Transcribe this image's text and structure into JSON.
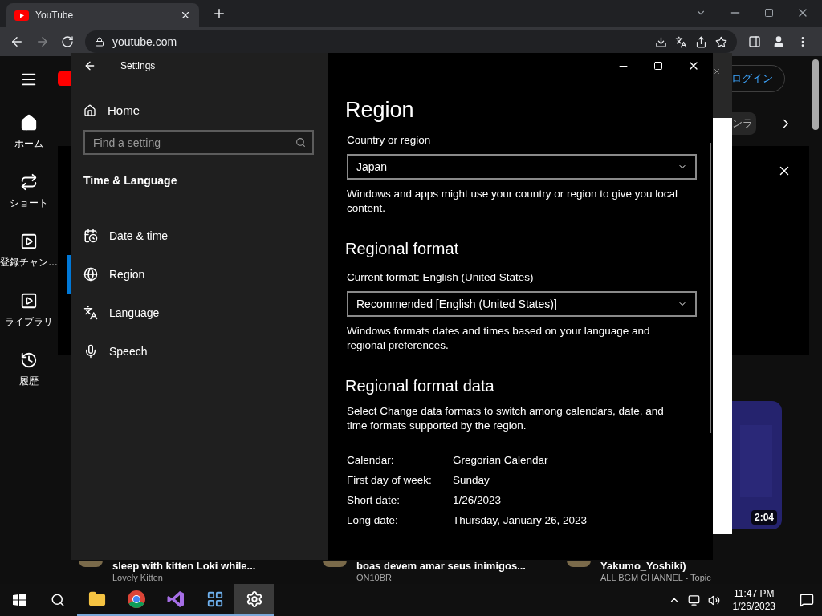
{
  "browser": {
    "tab_title": "YouTube",
    "address": "youtube.com"
  },
  "youtube": {
    "sidebar": [
      {
        "label": "ホーム"
      },
      {
        "label": "ショート"
      },
      {
        "label": "登録チャン…"
      },
      {
        "label": "ライブラリ"
      },
      {
        "label": "履歴"
      }
    ],
    "login": "ログイン",
    "chip": "ンラ",
    "duration": "2:04",
    "videos": [
      {
        "title": "sleep with kitten Loki while...",
        "channel": "Lovely Kitten"
      },
      {
        "title": "boas devem amar seus inimigos...",
        "channel": "ON10BR"
      },
      {
        "title": "Yakumo_Yoshiki)",
        "channel": "ALL BGM CHANNEL - Topic"
      }
    ]
  },
  "settings": {
    "title": "Settings",
    "home": "Home",
    "search": {
      "placeholder": "Find a setting"
    },
    "section": "Time & Language",
    "nav": [
      {
        "label": "Date & time",
        "selected": false
      },
      {
        "label": "Region",
        "selected": true
      },
      {
        "label": "Language",
        "selected": false
      },
      {
        "label": "Speech",
        "selected": false
      }
    ],
    "page_title": "Region",
    "country": {
      "label": "Country or region",
      "value": "Japan",
      "description": "Windows and apps might use your country or region to give you local content."
    },
    "format": {
      "heading": "Regional format",
      "current": "Current format: English (United States)",
      "value": "Recommended [English (United States)]",
      "description": "Windows formats dates and times based on your language and regional preferences."
    },
    "format_data": {
      "heading": "Regional format data",
      "description": "Select Change data formats to switch among calendars, date, and time formats supported by the region.",
      "rows": [
        {
          "label": "Calendar:",
          "value": "Gregorian Calendar"
        },
        {
          "label": "First day of week:",
          "value": "Sunday"
        },
        {
          "label": "Short date:",
          "value": "1/26/2023"
        },
        {
          "label": "Long date:",
          "value": "Thursday, January 26, 2023"
        }
      ]
    }
  },
  "taskbar": {
    "time": "11:47 PM",
    "date": "1/26/2023"
  }
}
